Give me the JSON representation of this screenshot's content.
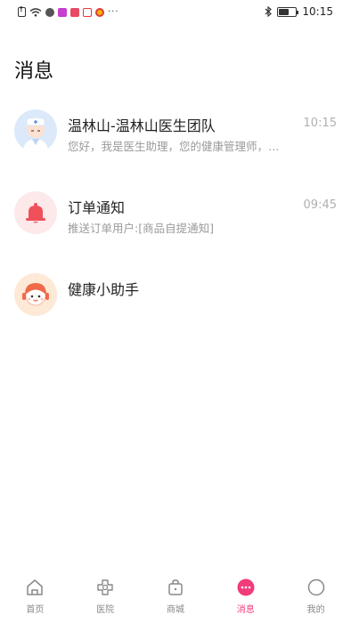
{
  "status_bar": {
    "time": "10:15",
    "dots": "···"
  },
  "page": {
    "title": "消息"
  },
  "messages": [
    {
      "name": "温林山-温林山医生团队",
      "preview": "您好，我是医生助理，您的健康管理师，…",
      "time": "10:15",
      "icon": "doctor-avatar-icon"
    },
    {
      "name": "订单通知",
      "preview": "推送订单用户:[商品自提通知]",
      "time": "09:45",
      "icon": "bell-icon"
    },
    {
      "name": "健康小助手",
      "preview": "",
      "time": "",
      "icon": "assistant-avatar-icon"
    }
  ],
  "tabs": [
    {
      "label": "首页",
      "icon": "home-icon",
      "active": false
    },
    {
      "label": "医院",
      "icon": "hospital-icon",
      "active": false
    },
    {
      "label": "商城",
      "icon": "shop-icon",
      "active": false
    },
    {
      "label": "消息",
      "icon": "message-icon",
      "active": true
    },
    {
      "label": "我的",
      "icon": "profile-icon",
      "active": false
    }
  ],
  "colors": {
    "accent": "#f03c7a",
    "bell_bg": "#fde8ea",
    "bell": "#f0505a",
    "doctor_bg": "#dce9fb",
    "assistant_bg": "#fde9d6"
  }
}
